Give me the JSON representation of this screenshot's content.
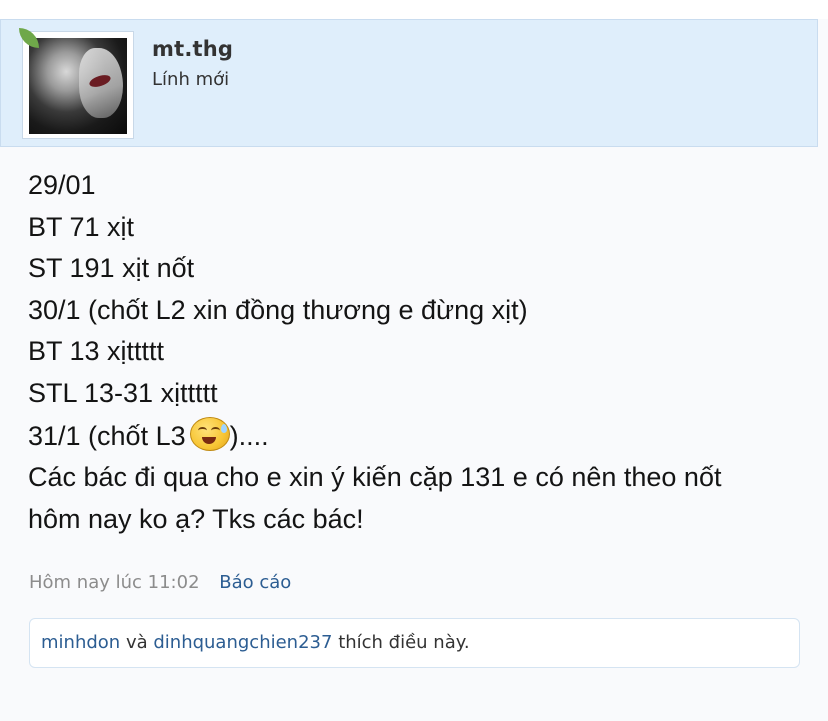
{
  "author": {
    "username": "mt.thg",
    "title": "Lính mới",
    "avatar_alt": "avatar"
  },
  "message": {
    "lines": [
      "29/01",
      "BT 71 xịt",
      "ST 191 xịt nốt",
      "30/1 (chốt L2 xin đồng thương e đừng xịt)",
      "BT 13 xịttttt",
      "STL 13-31 xịttttt"
    ],
    "line7_before": "31/1 (chốt L3",
    "line7_after": ")....",
    "line8": "Các bác đi qua cho e xin ý kiến cặp 131 e có nên theo nốt",
    "line9": "hôm nay ko ạ? Tks các bác!",
    "emoji_icon": "sweat-smile-emoji-icon"
  },
  "meta": {
    "timestamp": "Hôm nay lúc 11:02",
    "report_label": "Báo cáo"
  },
  "likes": {
    "user1": "minhdon",
    "conjunction": "và",
    "user2": "dinhquangchien237",
    "suffix": "thích điều này."
  },
  "colors": {
    "header_bg": "#dfeefb",
    "link": "#2c5d92",
    "online": "#6fa84a"
  }
}
